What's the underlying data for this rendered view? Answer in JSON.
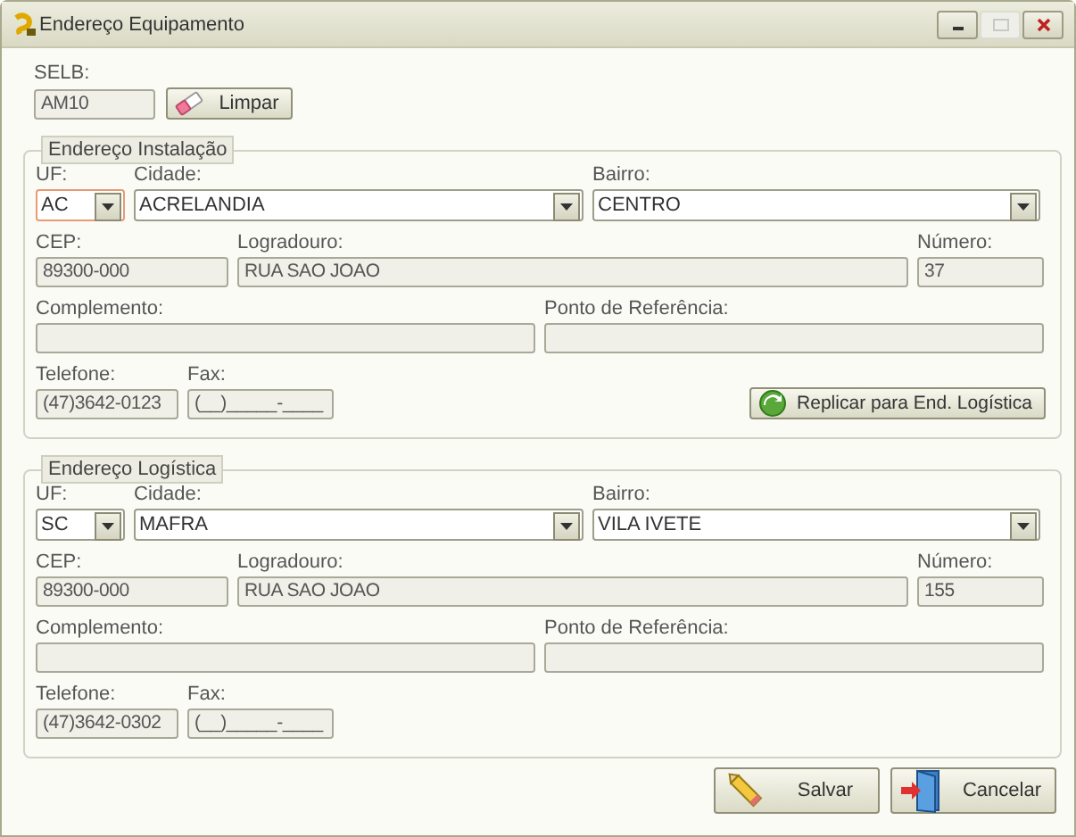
{
  "window": {
    "title": "Endereço Equipamento"
  },
  "selb": {
    "label": "SELB:",
    "value": "AM10"
  },
  "clear_button": {
    "label": "Limpar"
  },
  "groups": [
    {
      "title": "Endereço Instalação",
      "rows": [
        [
          {
            "label": "UF:",
            "kind": "combo",
            "value": "AC",
            "focused": true
          },
          {
            "label": "Cidade:",
            "kind": "combo",
            "value": "ACRELANDIA",
            "focused": false
          },
          {
            "label": "Bairro:",
            "kind": "combo",
            "value": "CENTRO",
            "focused": false
          }
        ],
        [
          {
            "label": "CEP:",
            "kind": "text",
            "value": "89300-000",
            "focused": false
          },
          {
            "label": "Logradouro:",
            "kind": "text",
            "value": "RUA SAO JOAO",
            "focused": false
          },
          {
            "label": "Número:",
            "kind": "text",
            "value": "37",
            "focused": false
          }
        ],
        [
          {
            "label": "Complemento:",
            "kind": "text",
            "focused": false
          },
          {
            "label": "Ponto de Referência:",
            "kind": "text",
            "focused": false
          }
        ],
        [
          {
            "label": "Telefone:",
            "kind": "text",
            "value": "(47)3642-0123",
            "focused": false
          },
          {
            "label": "Fax:",
            "kind": "text",
            "value": "(__)_____-____",
            "focused": false
          }
        ]
      ],
      "action_button": {
        "label": "Replicar para End. Logística"
      }
    },
    {
      "title": "Endereço Logística",
      "rows": [
        [
          {
            "label": "UF:",
            "kind": "combo",
            "value": "SC",
            "focused": false
          },
          {
            "label": "Cidade:",
            "kind": "combo",
            "value": "MAFRA",
            "focused": false
          },
          {
            "label": "Bairro:",
            "kind": "combo",
            "value": "VILA IVETE",
            "focused": false
          }
        ],
        [
          {
            "label": "CEP:",
            "kind": "text",
            "value": "89300-000",
            "focused": false
          },
          {
            "label": "Logradouro:",
            "kind": "text",
            "value": "RUA SAO JOAO",
            "focused": false
          },
          {
            "label": "Número:",
            "kind": "text",
            "value": "155",
            "focused": false
          }
        ],
        [
          {
            "label": "Complemento:",
            "kind": "text",
            "focused": false
          },
          {
            "label": "Ponto de Referência:",
            "kind": "text",
            "focused": false
          }
        ],
        [
          {
            "label": "Telefone:",
            "kind": "text",
            "value": "(47)3642-0302",
            "focused": false
          },
          {
            "label": "Fax:",
            "kind": "text",
            "value": "(__)_____-____",
            "focused": false
          }
        ]
      ]
    }
  ],
  "buttons": [
    {
      "label": "Salvar",
      "kind": "save"
    },
    {
      "label": "Cancelar",
      "kind": "cancel"
    }
  ]
}
